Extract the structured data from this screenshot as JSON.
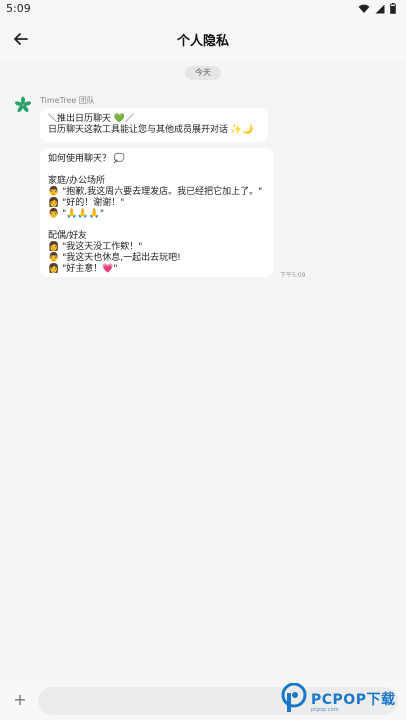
{
  "status_bar": {
    "time": "5:09"
  },
  "app_bar": {
    "title": "个人隐私"
  },
  "chat": {
    "date_chip": "今天",
    "sender": "TimeTree 团队",
    "messages": [
      {
        "lines": [
          "＼推出日历聊天 💚／",
          "日历聊天这款工具能让您与其他成员展开对话 ✨🌙"
        ]
      },
      {
        "lines": [
          "如何使用聊天？ 💭",
          "",
          "家庭/办公场所",
          "👨 \"抱歉,我这周六要去理发店。我已经把它加上了。\"",
          "👩 \"好的！谢谢！\"",
          "👨 \"🙏🙏🙏\"",
          "",
          "配偶/好友",
          "👩 \"我这天没工作欸！\"",
          "👨 \"我这天也休息,一起出去玩吧!",
          "👩 \"好主意！💗\""
        ]
      }
    ],
    "message_time": "下午5:09"
  },
  "composer": {
    "plus": "+",
    "placeholder": ""
  },
  "watermark": {
    "brand": "PCPOP下载",
    "sub": "pcpop.com"
  },
  "colors": {
    "background": "#f5f5f5",
    "bubble": "#ffffff",
    "brand": "#1b78c9",
    "avatar": "#2aa06a"
  }
}
